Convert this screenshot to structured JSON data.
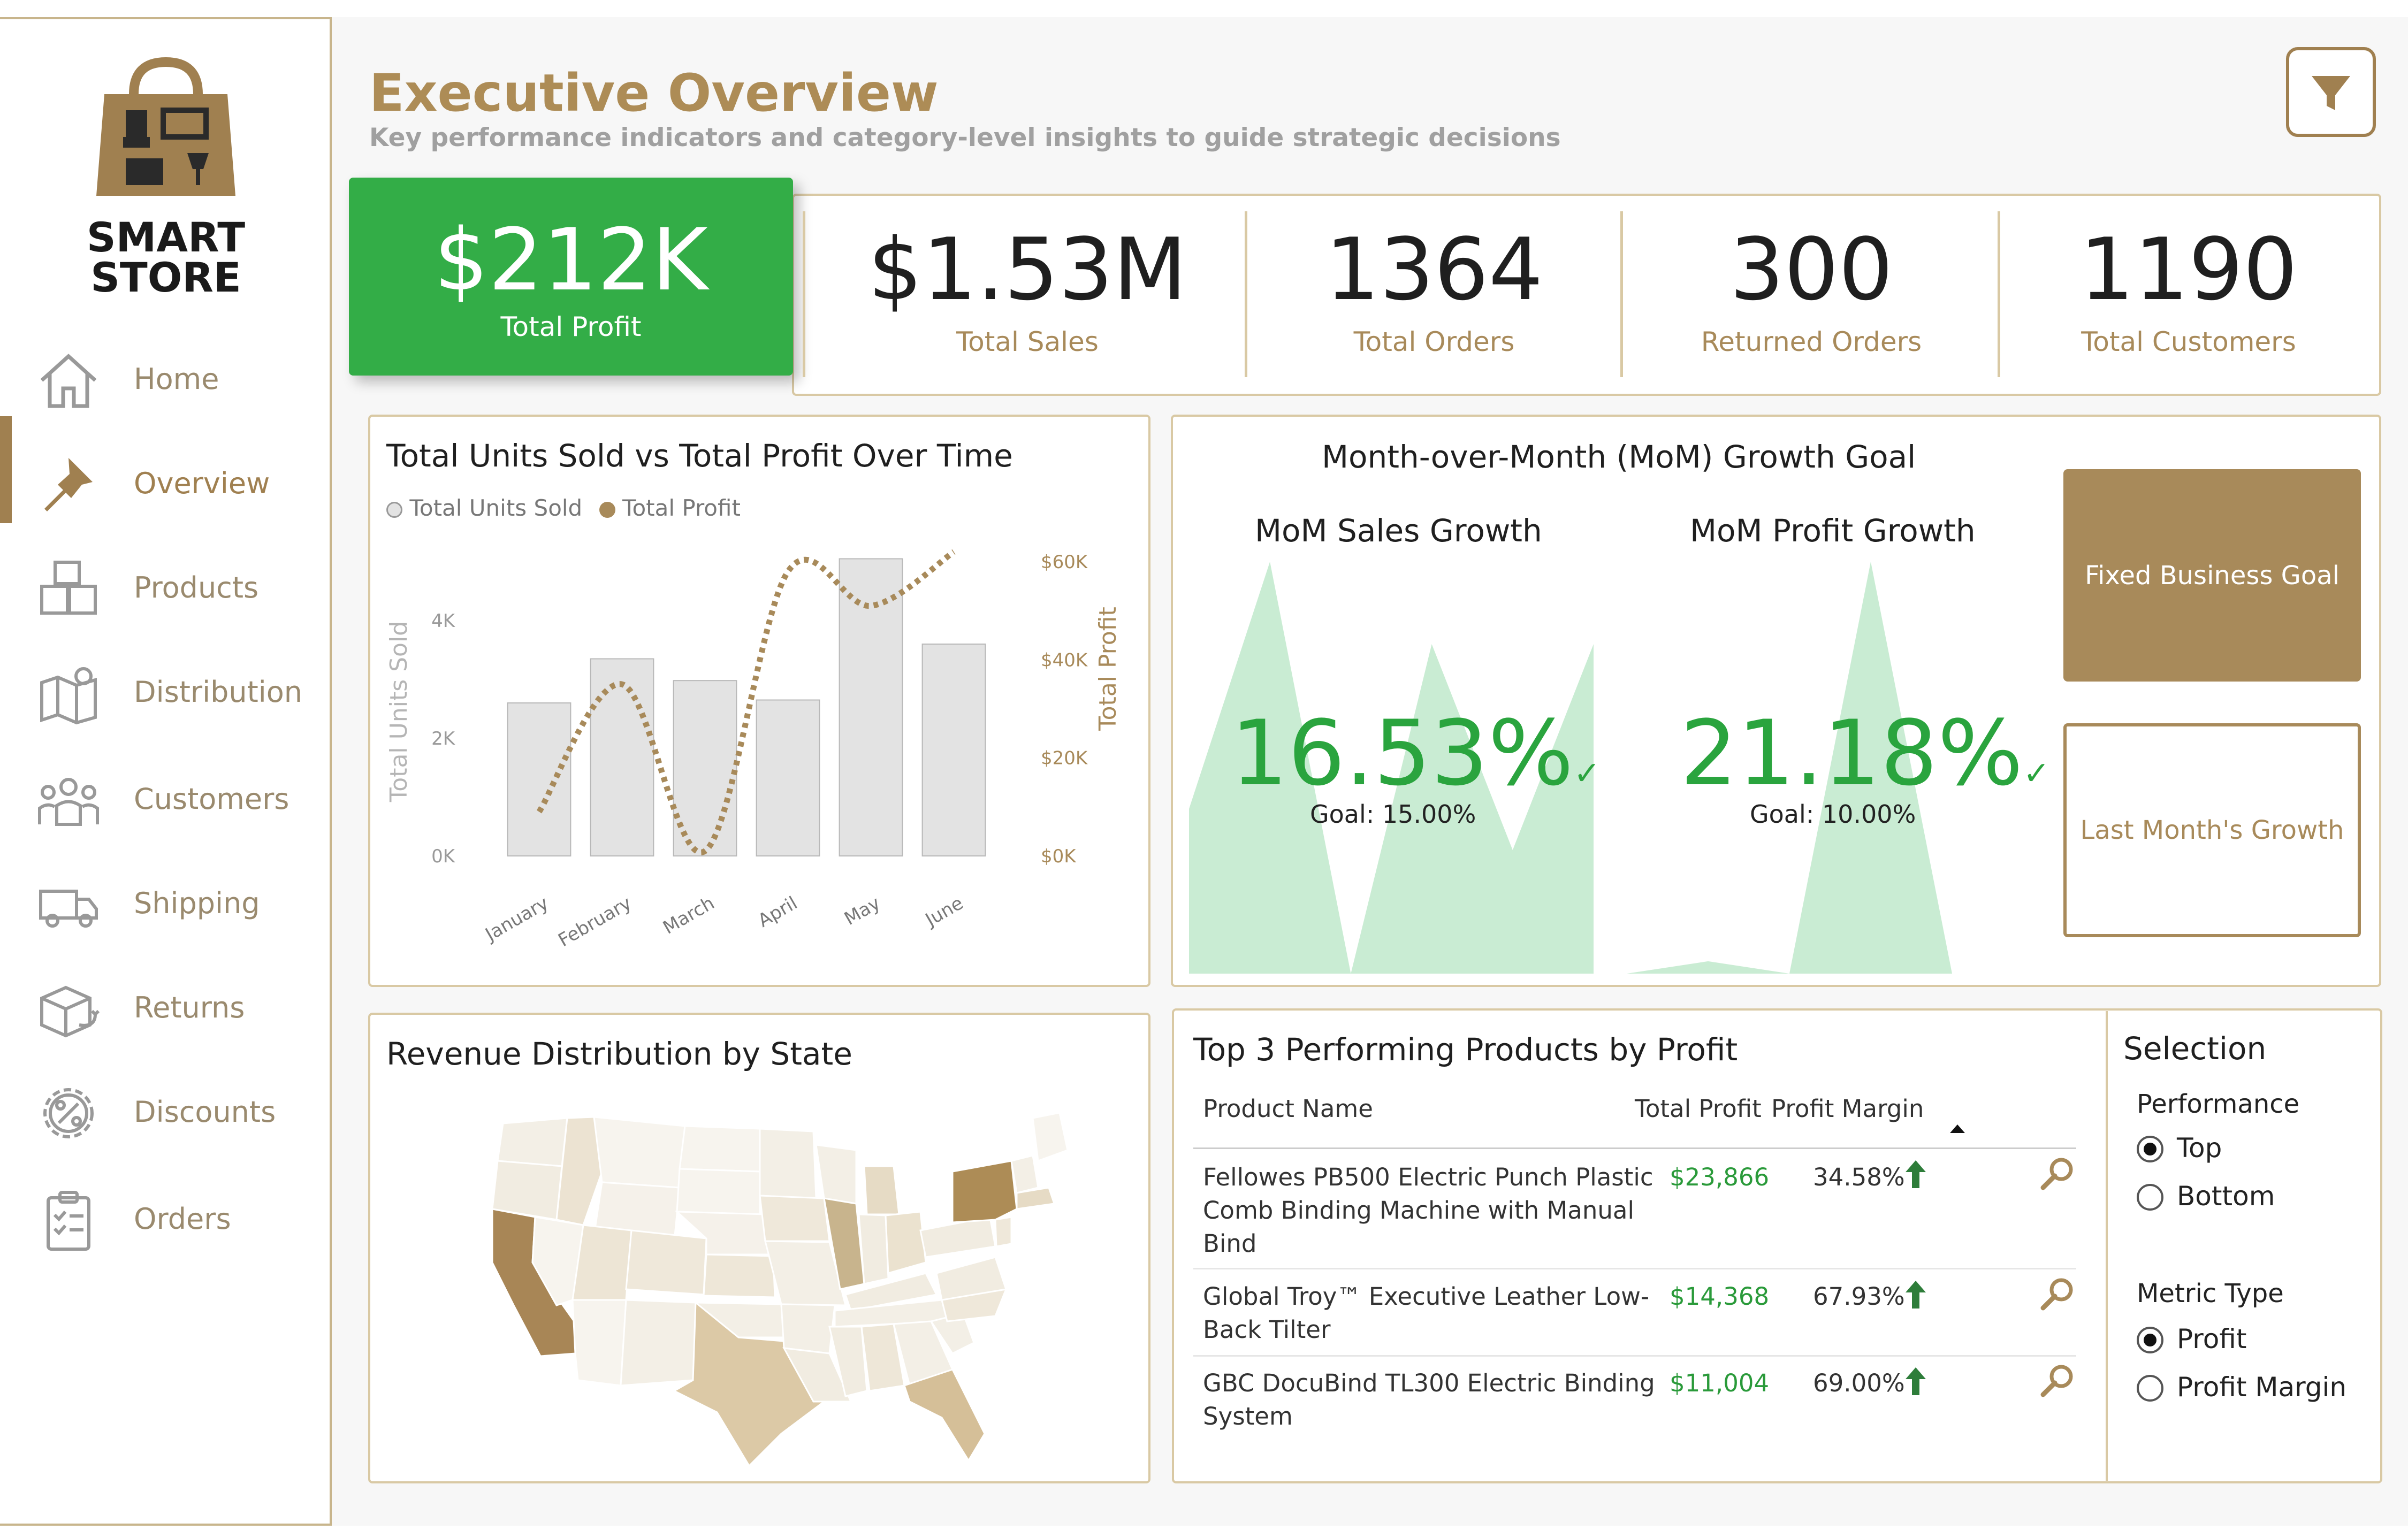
{
  "brand": {
    "line1": "SMART",
    "line2": "STORE"
  },
  "nav": [
    {
      "label": "Home",
      "icon": "home-icon"
    },
    {
      "label": "Overview",
      "icon": "pin-icon",
      "active": true
    },
    {
      "label": "Products",
      "icon": "boxes-icon"
    },
    {
      "label": "Distribution",
      "icon": "map-pin-icon"
    },
    {
      "label": "Customers",
      "icon": "people-icon"
    },
    {
      "label": "Shipping",
      "icon": "truck-icon"
    },
    {
      "label": "Returns",
      "icon": "return-box-icon"
    },
    {
      "label": "Discounts",
      "icon": "percent-gear-icon"
    },
    {
      "label": "Orders",
      "icon": "clipboard-icon"
    }
  ],
  "header": {
    "title": "Executive Overview",
    "subtitle": "Key performance indicators and category-level insights to guide strategic decisions"
  },
  "kpis": {
    "profit": {
      "value": "$212K",
      "label": "Total Profit"
    },
    "items": [
      {
        "value": "$1.53M",
        "label": "Total Sales"
      },
      {
        "value": "1364",
        "label": "Total Orders"
      },
      {
        "value": "300",
        "label": "Returned Orders"
      },
      {
        "value": "1190",
        "label": "Total Customers"
      }
    ]
  },
  "combo": {
    "title": "Total Units Sold vs Total Profit Over Time",
    "legend": [
      "Total Units Sold",
      "Total Profit"
    ],
    "y_left_label": "Total Units Sold",
    "y_right_label": "Total Profit",
    "y_left_ticks": [
      "0K",
      "2K",
      "4K"
    ],
    "y_right_ticks": [
      "$0K",
      "$20K",
      "$40K",
      "$60K"
    ]
  },
  "chart_data": [
    {
      "type": "bar",
      "title": "Total Units Sold vs Total Profit Over Time",
      "categories": [
        "January",
        "February",
        "March",
        "April",
        "May",
        "June"
      ],
      "series": [
        {
          "name": "Total Units Sold",
          "type": "bar",
          "axis": "left",
          "values": [
            2600,
            3350,
            2980,
            2650,
            5050,
            3600
          ]
        },
        {
          "name": "Total Profit",
          "type": "line",
          "axis": "right",
          "values": [
            9000,
            35000,
            1000,
            58000,
            51000,
            62000
          ]
        }
      ],
      "ylim_left": [
        0,
        5000
      ],
      "ylim_right": [
        0,
        60000
      ],
      "bar_color": "#e3e3e3",
      "line_color": "#a88a5a"
    },
    {
      "type": "area",
      "title": "MoM Sales Growth",
      "values": [
        40,
        100,
        0,
        80,
        30,
        80
      ],
      "color": "#c9ecd3"
    },
    {
      "type": "area",
      "title": "MoM Profit Growth",
      "values": [
        0,
        3,
        0,
        100,
        0,
        0
      ],
      "color": "#c9ecd3"
    }
  ],
  "mom": {
    "title": "Month-over-Month (MoM) Growth Goal",
    "sales": {
      "title": "MoM Sales Growth",
      "value": "16.53%",
      "goal": "Goal: 15.00%"
    },
    "profit": {
      "title": "MoM Profit Growth",
      "value": "21.18%",
      "goal": "Goal: 10.00%"
    },
    "btn_fixed": "Fixed Business Goal",
    "btn_last": "Last Month's Growth"
  },
  "map": {
    "title": "Revenue Distribution by State"
  },
  "top3": {
    "title": "Top 3 Performing Products by Profit",
    "headers": [
      "Product Name",
      "Total Profit",
      "Profit Margin"
    ],
    "rows": [
      {
        "name": [
          "Fellowes PB500 Electric Punch Plastic",
          "Comb Binding Machine with Manual",
          "Bind"
        ],
        "profit": "$23,866",
        "margin": "34.58%"
      },
      {
        "name": [
          "Global Troy™ Executive Leather Low-",
          "Back Tilter"
        ],
        "profit": "$14,368",
        "margin": "67.93%"
      },
      {
        "name": [
          "GBC DocuBind TL300 Electric Binding",
          "System"
        ],
        "profit": "$11,004",
        "margin": "69.00%"
      }
    ]
  },
  "selection": {
    "title": "Selection",
    "performance": {
      "label": "Performance",
      "options": [
        "Top",
        "Bottom"
      ],
      "selected": "Top"
    },
    "metric": {
      "label": "Metric Type",
      "options": [
        "Profit",
        "Profit Margin"
      ],
      "selected": "Profit"
    }
  },
  "colors": {
    "accent": "#a88a5a",
    "green": "#33ad47",
    "border": "#d9c9a4"
  }
}
